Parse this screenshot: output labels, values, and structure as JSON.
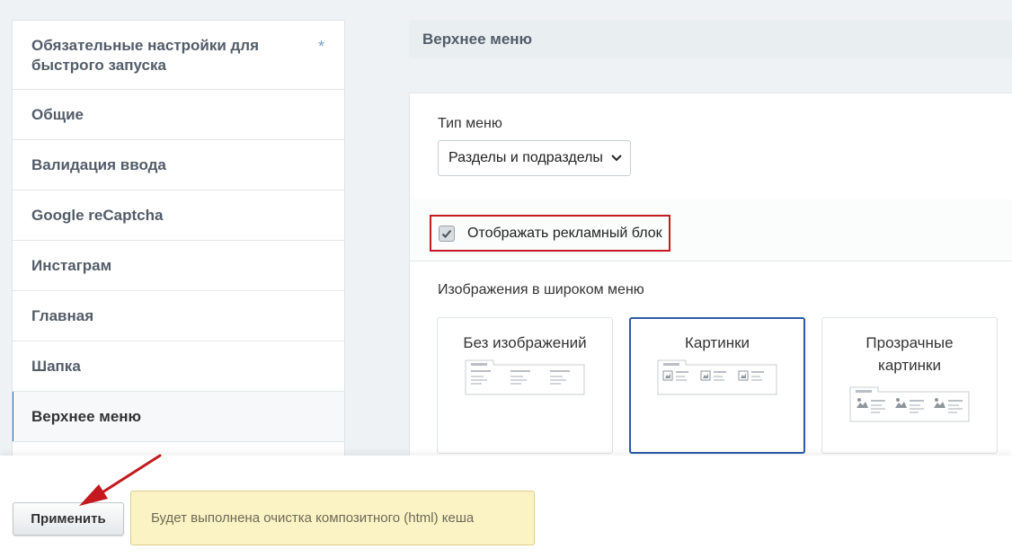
{
  "sidebar": {
    "items": [
      {
        "label": "Обязательные настройки для быстрого запуска",
        "marker": "*"
      },
      {
        "label": "Общие"
      },
      {
        "label": "Валидация ввода"
      },
      {
        "label": "Google reCaptcha"
      },
      {
        "label": "Инстаграм"
      },
      {
        "label": "Главная"
      },
      {
        "label": "Шапка"
      },
      {
        "label": "Верхнее меню",
        "active": true
      }
    ]
  },
  "section": {
    "title": "Верхнее меню"
  },
  "menu_type": {
    "label": "Тип меню",
    "selected": "Разделы и подразделы"
  },
  "ad_block": {
    "label": "Отображать рекламный блок",
    "checked": true
  },
  "wide_menu_images": {
    "label": "Изображения в широком меню",
    "options": [
      {
        "label": "Без изображений",
        "icon": "no-images-preview-icon"
      },
      {
        "label": "Картинки",
        "icon": "images-preview-icon",
        "selected": true
      },
      {
        "label": "Прозрачные картинки",
        "icon": "transparent-images-preview-icon"
      }
    ]
  },
  "footer": {
    "apply_label": "Применить",
    "notice": "Будет выполнена очистка композитного (html) кеша"
  },
  "colors": {
    "accent": "#2b5ba8",
    "highlight_border": "#c51a1f",
    "notice_bg": "#fbf3c4"
  }
}
